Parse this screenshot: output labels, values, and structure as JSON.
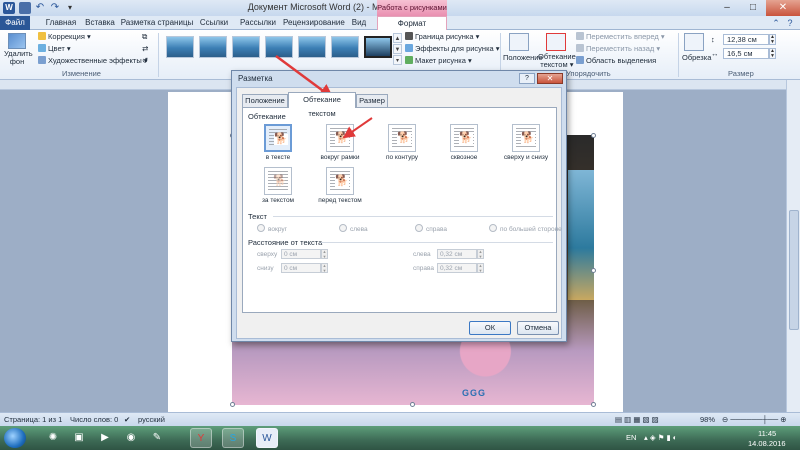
{
  "window": {
    "title": "Документ Microsoft Word (2) - Microsoft Word",
    "context_group": "Работа с рисунками",
    "qat_word": "W",
    "undo_symbol": "↶",
    "redo_symbol": "↷",
    "more_symbol": "▾",
    "min_symbol": "–",
    "max_symbol": "□",
    "close_symbol": "✕"
  },
  "tabs": [
    "Файл",
    "Главная",
    "Вставка",
    "Разметка страницы",
    "Ссылки",
    "Рассылки",
    "Рецензирование",
    "Вид",
    "Формат"
  ],
  "ribbon": {
    "remove_bg": "Удалить\nфон",
    "correction": "Коррекция ▾",
    "color": "Цвет ▾",
    "effects": "Художественные эффекты ▾",
    "group_change": "Изменение",
    "border": "Граница рисунка ▾",
    "pic_effects": "Эффекты для рисунка ▾",
    "pic_layout": "Макет рисунка ▾",
    "position": "Положение",
    "wrap_text": "Обтекание\nтекстом ▾",
    "bring_forward": "Переместить вперед ▾",
    "send_backward": "Переместить назад ▾",
    "selection_pane": "Область выделения",
    "group_arrange": "Упорядочить",
    "crop": "Обрезка",
    "height": "12,38 см",
    "width": "16,5 см",
    "group_size": "Размер"
  },
  "dialog": {
    "title": "Разметка",
    "help": "?",
    "close": "✕",
    "tabs": {
      "position": "Положение",
      "wrap": "Обтекание текстом",
      "size": "Размер"
    },
    "section_wrap": "Обтекание",
    "wrap_options": [
      "в тексте",
      "вокруг рамки",
      "по контуру",
      "сквозное",
      "сверху и снизу",
      "за текстом",
      "перед текстом"
    ],
    "section_text": "Текст",
    "text_options": [
      "вокруг",
      "слева",
      "справа",
      "по большей стороне"
    ],
    "section_distance": "Расстояние от текста",
    "top_label": "сверху",
    "top_value": "0 см",
    "bottom_label": "снизу",
    "bottom_value": "0 см",
    "left_label": "слева",
    "left_value": "0,32 см",
    "right_label": "справа",
    "right_value": "0,32 см",
    "ok": "ОК",
    "cancel": "Отмена",
    "dog_glyph": "🐕"
  },
  "status": {
    "page": "Страница: 1 из 1",
    "words": "Число слов: 0",
    "lang": "русский",
    "zoom": "98%"
  },
  "document": {
    "logo_text": "GGG"
  },
  "taskbar": {
    "lang": "EN",
    "time": "11:45",
    "date": "14.08.2016"
  },
  "colors": {
    "accent": "#2b579a",
    "context_tab": "#e98fb0",
    "arrow": "#e03a3a"
  }
}
